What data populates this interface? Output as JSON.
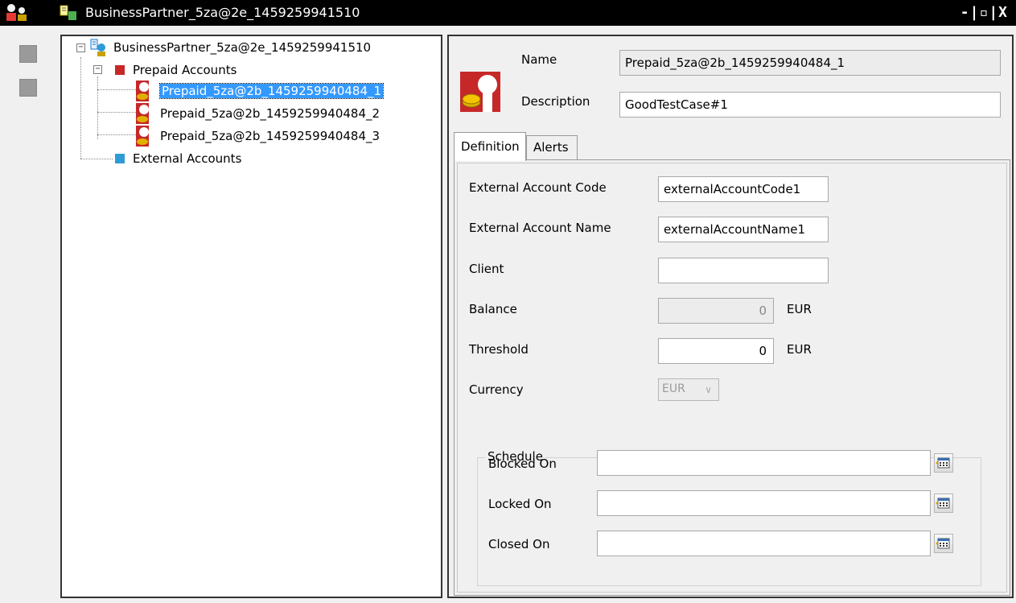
{
  "window": {
    "title": "BusinessPartner_5za@2e_1459259941510",
    "controls": {
      "minimize": "-",
      "restore": "▫",
      "close": "X"
    }
  },
  "tree": {
    "root": {
      "label": "BusinessPartner_5za@2e_1459259941510",
      "icon": "business-partner-icon"
    },
    "groups": [
      {
        "label": "Prepaid Accounts",
        "color": "#c62828",
        "items": [
          {
            "label": "Prepaid_5za@2b_1459259940484_1",
            "selected": true
          },
          {
            "label": "Prepaid_5za@2b_1459259940484_2",
            "selected": false
          },
          {
            "label": "Prepaid_5za@2b_1459259940484_3",
            "selected": false
          }
        ]
      },
      {
        "label": "External Accounts",
        "color": "#2f9bd6",
        "items": []
      }
    ]
  },
  "detail": {
    "name_label": "Name",
    "name_value": "Prepaid_5za@2b_1459259940484_1",
    "description_label": "Description",
    "description_value": "GoodTestCase#1",
    "tabs": [
      {
        "label": "Definition",
        "active": true
      },
      {
        "label": "Alerts",
        "active": false
      }
    ],
    "definition": {
      "external_account_code_label": "External Account Code",
      "external_account_code_value": "externalAccountCode1",
      "external_account_name_label": "External Account Name",
      "external_account_name_value": "externalAccountName1",
      "client_label": "Client",
      "client_value": "",
      "balance_label": "Balance",
      "balance_value": "0",
      "balance_unit": "EUR",
      "threshold_label": "Threshold",
      "threshold_value": "0",
      "threshold_unit": "EUR",
      "currency_label": "Currency",
      "currency_value": "EUR",
      "schedule": {
        "legend": "Schedule",
        "blocked_on_label": "Blocked On",
        "blocked_on_value": "",
        "locked_on_label": "Locked On",
        "locked_on_value": "",
        "closed_on_label": "Closed On",
        "closed_on_value": ""
      }
    }
  },
  "colors": {
    "selection": "#3399ff",
    "titlebar": "#000000"
  }
}
